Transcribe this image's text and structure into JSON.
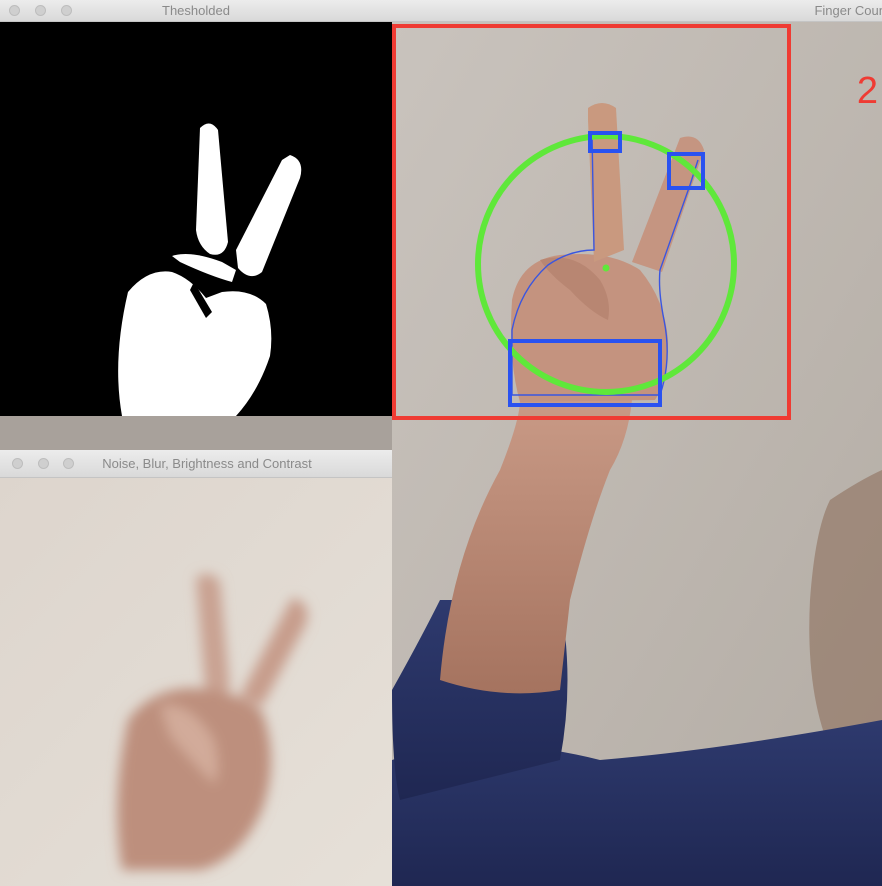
{
  "windows": {
    "threshold": {
      "title": "Thesholded"
    },
    "finger_count": {
      "title": "Finger Coun",
      "count": "2"
    },
    "blur": {
      "title": "Noise, Blur, Brightness and Contrast"
    }
  },
  "colors": {
    "roi_box": "#ef3b33",
    "hull_circle": "#5fe83a",
    "finger_boxes": "#2a52f0",
    "contour": "#3a56e0"
  }
}
